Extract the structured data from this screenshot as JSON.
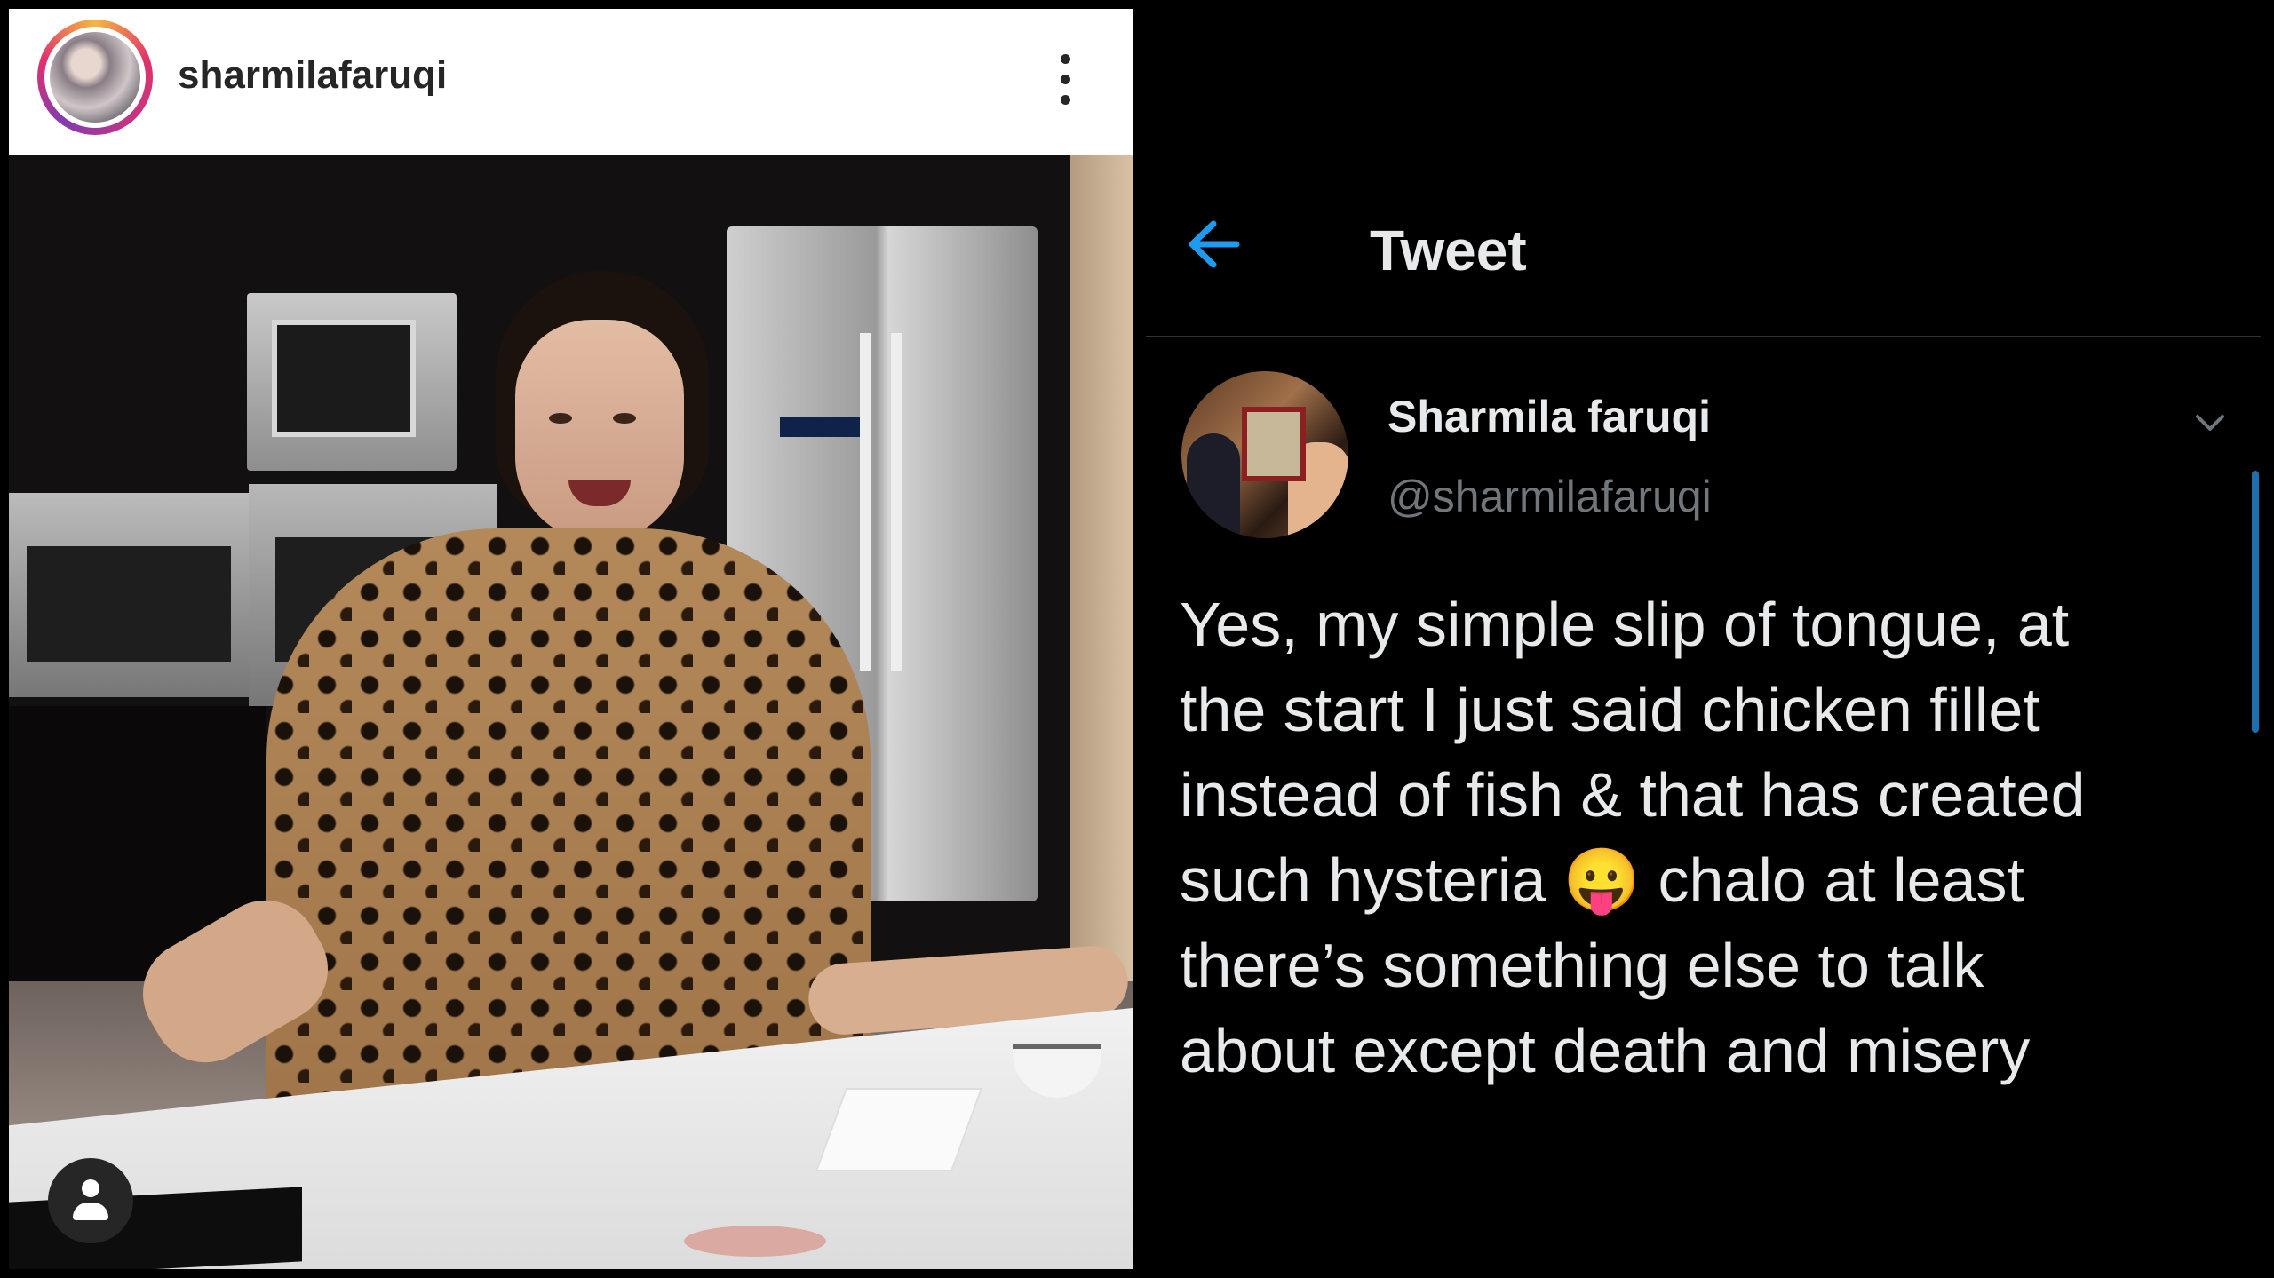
{
  "instagram": {
    "username": "sharmilafaruqi",
    "icons": {
      "more": "more-vertical-icon",
      "user": "user-icon"
    },
    "ring_colors": [
      "#f5b642",
      "#e1306c",
      "#833ab4"
    ]
  },
  "tweet": {
    "header_title": "Tweet",
    "back_icon": "arrow-left-icon",
    "display_name": "Sharmila faruqi",
    "handle": "@sharmilafaruqi",
    "text": "Yes, my simple slip of tongue, at\nthe start I just said chicken fillet\ninstead of fish & that has created\nsuch hysteria 😛 chalo at least\nthere’s something else to talk\nabout except death and misery",
    "accent_color": "#1d9bf0"
  }
}
